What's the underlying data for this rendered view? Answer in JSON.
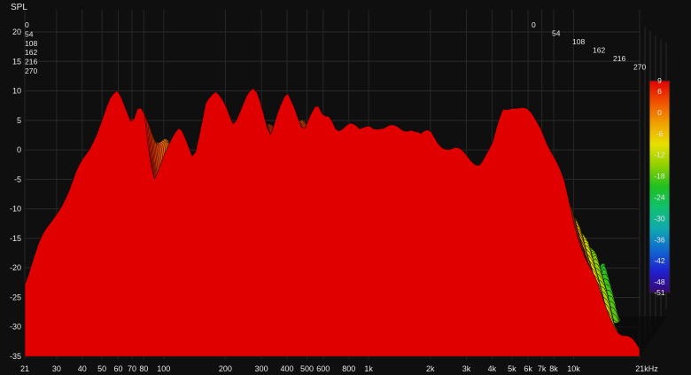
{
  "chart_data": {
    "type": "area",
    "subtype": "waterfall-3d",
    "title": "",
    "ylabel": "SPL",
    "xlabel": "",
    "x_scale": "log",
    "x_ticks": [
      21,
      30,
      40,
      50,
      60,
      70,
      80,
      100,
      200,
      300,
      400,
      500,
      600,
      800,
      1000,
      2000,
      3000,
      4000,
      5000,
      6000,
      7000,
      8000,
      10000,
      21000
    ],
    "x_tick_labels": [
      "21",
      "30",
      "40",
      "50",
      "60",
      "70",
      "80",
      "100",
      "200",
      "300",
      "400",
      "500",
      "600",
      "800",
      "1k",
      "2k",
      "3k",
      "4k",
      "5k",
      "6k",
      "7k",
      "8k",
      "10k",
      "21kHz"
    ],
    "xlim": [
      21,
      21000
    ],
    "y_ticks": [
      20,
      15,
      10,
      5,
      0,
      -5,
      -10,
      -15,
      -20,
      -25,
      -30,
      -35
    ],
    "ylim": [
      -36,
      22
    ],
    "depth_axis_labels": [
      "0",
      "54",
      "108",
      "162",
      "216",
      "270"
    ],
    "colorbar": {
      "ticks": [
        9,
        6,
        0,
        -6,
        -12,
        -18,
        -24,
        -30,
        -36,
        -42,
        -48,
        -51
      ],
      "range": [
        -51,
        9
      ],
      "colors": [
        "#3a0870",
        "#2020d0",
        "#1068d0",
        "#10a8b0",
        "#10c070",
        "#20c020",
        "#90d000",
        "#e8e000",
        "#f0a000",
        "#f05000",
        "#e00000"
      ]
    },
    "grid": true,
    "front_slice": {
      "freq_hz": [
        21,
        25,
        30,
        35,
        40,
        45,
        50,
        55,
        60,
        65,
        70,
        75,
        80,
        85,
        90,
        100,
        110,
        120,
        140,
        160,
        180,
        200,
        220,
        240,
        260,
        280,
        300,
        330,
        360,
        400,
        440,
        480,
        520,
        560,
        600,
        650,
        700,
        800,
        900,
        1000,
        1200,
        1400,
        1600,
        1800,
        2000,
        2500,
        3000,
        3500,
        4000,
        4500,
        5000,
        5500,
        6000,
        6500,
        7000,
        8000,
        9000,
        10000,
        12000,
        14000,
        17000,
        21000
      ],
      "spl_db": [
        -22,
        -16,
        -10,
        -7,
        -2,
        2,
        5,
        8,
        10,
        8,
        5,
        7,
        6,
        -2,
        -5,
        0,
        2,
        3,
        -1,
        8,
        9,
        8,
        5,
        7,
        9,
        10,
        8,
        3,
        6,
        9,
        7,
        4,
        6,
        7,
        5,
        6,
        4,
        4,
        3,
        5,
        3,
        4,
        4,
        2,
        3,
        0,
        -1,
        -2,
        0,
        7,
        8,
        7,
        6,
        5,
        4,
        -1,
        -6,
        -12,
        -20,
        -26,
        -31,
        -34
      ]
    },
    "time_slices": 270,
    "slice_step": 54
  }
}
